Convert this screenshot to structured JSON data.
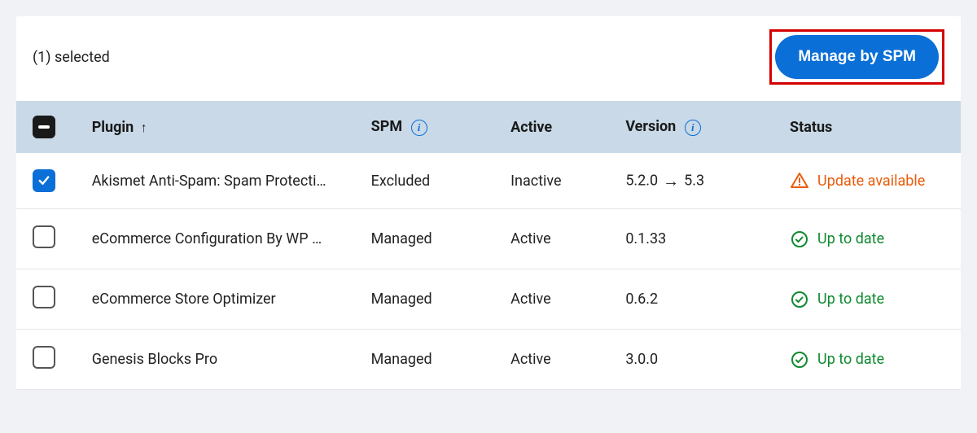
{
  "selection": {
    "count_text": "(1) selected"
  },
  "actions": {
    "manage_label": "Manage by SPM"
  },
  "columns": {
    "plugin": "Plugin",
    "spm": "SPM",
    "active": "Active",
    "version": "Version",
    "status": "Status"
  },
  "rows": [
    {
      "checked": true,
      "name": "Akismet Anti-Spam: Spam Protecti…",
      "spm": "Excluded",
      "active": "Inactive",
      "version_from": "5.2.0",
      "version_to": "5.3",
      "status": "Update available",
      "status_kind": "update"
    },
    {
      "checked": false,
      "name": "eCommerce Configuration By WP …",
      "spm": "Managed",
      "active": "Active",
      "version_from": "0.1.33",
      "version_to": "",
      "status": "Up to date",
      "status_kind": "ok"
    },
    {
      "checked": false,
      "name": "eCommerce Store Optimizer",
      "spm": "Managed",
      "active": "Active",
      "version_from": "0.6.2",
      "version_to": "",
      "status": "Up to date",
      "status_kind": "ok"
    },
    {
      "checked": false,
      "name": "Genesis Blocks Pro",
      "spm": "Managed",
      "active": "Active",
      "version_from": "3.0.0",
      "version_to": "",
      "status": "Up to date",
      "status_kind": "ok"
    }
  ],
  "icons": {
    "sort_up": "↑",
    "info": "i",
    "arrow_right": "→"
  },
  "colors": {
    "primary": "#0a6fd6",
    "update": "#e85c0b",
    "ok": "#0f8a2f",
    "highlight_border": "#d40000"
  }
}
